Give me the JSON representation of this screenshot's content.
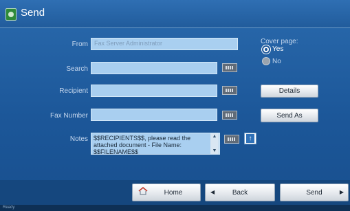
{
  "window": {
    "title": "Send"
  },
  "form": {
    "from": {
      "label": "From",
      "value": "Fax Server Administrator"
    },
    "search": {
      "label": "Search",
      "value": ""
    },
    "recipient": {
      "label": "Recipient",
      "value": ""
    },
    "fax_number": {
      "label": "Fax Number",
      "value": ""
    },
    "notes": {
      "label": "Notes",
      "value": "$$RECIPIENTS$$, please read the attached document - File Name: $$FILENAME$$"
    }
  },
  "cover_page": {
    "label": "Cover page:",
    "options": [
      "Yes",
      "No"
    ],
    "selected": "Yes"
  },
  "buttons": {
    "details": "Details",
    "send_as": "Send As"
  },
  "nav": {
    "home": "Home",
    "back": "Back",
    "send": "Send"
  },
  "status": {
    "text": "Ready"
  },
  "colors": {
    "background": "#1c5799",
    "field": "#a9cff0",
    "accent": "#2f71b8"
  }
}
